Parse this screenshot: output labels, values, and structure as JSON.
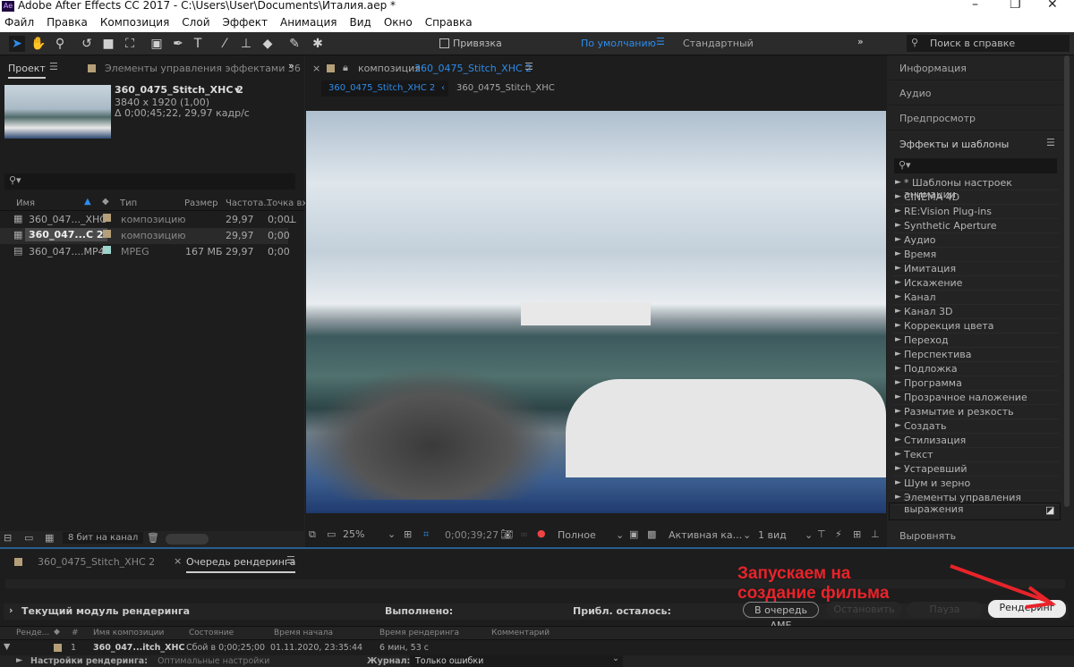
{
  "app": {
    "title": "Adobe After Effects CC 2017 - C:\\Users\\User\\Documents\\Италия.aep *",
    "logo": "Ae"
  },
  "menu": [
    "Файл",
    "Правка",
    "Композиция",
    "Слой",
    "Эффект",
    "Анимация",
    "Вид",
    "Окно",
    "Справка"
  ],
  "toolbar": {
    "snap_label": "Привязка",
    "workspace_active": "По умолчанию",
    "workspace_other": "Стандартный",
    "help_search_placeholder": "Поиск в справке",
    "tools": [
      "selection-icon",
      "hand-icon",
      "zoom-icon",
      "rotate-icon",
      "camera-icon",
      "pan-behind-icon",
      "rectangle-icon",
      "pen-icon",
      "type-icon",
      "brush-icon",
      "clone-stamp-icon",
      "eraser-icon",
      "roto-brush-icon",
      "puppet-pin-icon"
    ]
  },
  "project": {
    "tab": "Проект",
    "tab2": "Элементы управления эффектами 36",
    "comp_name": "360_0475_Stitch_XHC 2",
    "comp_size": "3840 x 1920 (1,00)",
    "comp_duration": "Δ 0;00;45;22, 29,97 кадр/с",
    "columns": [
      "Имя",
      "Тип",
      "Размер",
      "Частота...",
      "Точка вх"
    ],
    "items": [
      {
        "name": "360_047..._XHC",
        "type": "композицию",
        "size": "",
        "rate": "29,97",
        "in": "0;00",
        "color": "#b59f79"
      },
      {
        "name": "360_047...C 2",
        "type": "композицию",
        "size": "",
        "rate": "29,97",
        "in": "0;00",
        "color": "#b59f79"
      },
      {
        "name": "360_047....MP4",
        "type": "MPEG",
        "size": "167 МБ",
        "rate": "29,97",
        "in": "0;00",
        "color": "#9dd3cc"
      }
    ],
    "bit_depth": "8 бит на канал"
  },
  "composition": {
    "tab_prefix": "композиция",
    "tab_name": "360_0475_Stitch_XHC 2",
    "breadcrumb_active": "360_0475_Stitch_XHC 2",
    "breadcrumb_other": "360_0475_Stitch_XHC",
    "zoom": "25%",
    "timecode": "0;00;39;27",
    "resolution": "Полное",
    "camera": "Активная ка...",
    "views": "1 вид"
  },
  "right": {
    "panels": [
      "Информация",
      "Аудио",
      "Предпросмотр"
    ],
    "effects_title": "Эффекты и шаблоны",
    "effects": [
      "* Шаблоны настроек анимации",
      "CINEMA 4D",
      "RE:Vision Plug-ins",
      "Synthetic Aperture",
      "Аудио",
      "Время",
      "Имитация",
      "Искажение",
      "Канал",
      "Канал 3D",
      "Коррекция цвета",
      "Переход",
      "Перспектива",
      "Подложка",
      "Программа",
      "Прозрачное наложение",
      "Размытие и резкость",
      "Создать",
      "Стилизация",
      "Текст",
      "Устаревший",
      "Шум и зерно",
      "Элементы управления выражения"
    ],
    "align": "Выровнять"
  },
  "render": {
    "tab1": "360_0475_Stitch_XHC 2",
    "tab2": "Очередь рендеринга",
    "current_module": "Текущий модуль рендеринга",
    "done_label": "Выполнено:",
    "remaining_label": "Прибл. осталось:",
    "btn_ame": "В очередь AME",
    "btn_stop": "Остановить",
    "btn_pause": "Пауза",
    "btn_render": "Рендеринг",
    "columns": [
      "Ренде...",
      "#",
      "Имя композиции",
      "Состояние",
      "Время начала",
      "Время рендеринга",
      "Комментарий"
    ],
    "item": {
      "num": "1",
      "name": "360_047...itch_XHC",
      "status": "Сбой в 0;00;25;00",
      "start": "01.11.2020, 23:35:44",
      "render_time": "6 мин, 53 с"
    },
    "settings_label": "Настройки рендеринга:",
    "settings_value": "Оптимальные настройки",
    "log_label": "Журнал:",
    "log_value": "Только ошибки"
  },
  "annotation": {
    "text_line1": "Запускаем на",
    "text_line2": "создание фильма",
    "color": "#e8232a"
  }
}
